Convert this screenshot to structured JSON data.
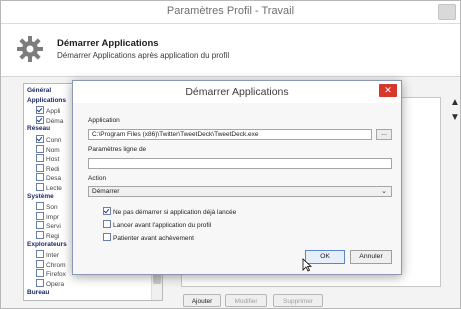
{
  "window": {
    "title": "Paramètres Profil - Travail"
  },
  "header": {
    "icon": "gear-icon",
    "title": "Démarrer Applications",
    "subtitle": "Démarrer Applications après application du profil"
  },
  "tree": {
    "items": [
      {
        "label": "Général",
        "level": "cat",
        "checked": null
      },
      {
        "label": "Applications",
        "level": "cat",
        "checked": null
      },
      {
        "label": "Appli",
        "level": "sub",
        "checked": true
      },
      {
        "label": "Déma",
        "level": "sub",
        "checked": true
      },
      {
        "label": "Réseau",
        "level": "cat",
        "checked": null
      },
      {
        "label": "Conn",
        "level": "sub",
        "checked": true
      },
      {
        "label": "Nom",
        "level": "sub",
        "checked": false
      },
      {
        "label": "Host",
        "level": "sub",
        "checked": false
      },
      {
        "label": "Redi",
        "level": "sub",
        "checked": false
      },
      {
        "label": "Desa",
        "level": "sub",
        "checked": false
      },
      {
        "label": "Lecte",
        "level": "sub",
        "checked": false
      },
      {
        "label": "Système",
        "level": "cat",
        "checked": null
      },
      {
        "label": "Son",
        "level": "sub",
        "checked": false
      },
      {
        "label": "Impr",
        "level": "sub",
        "checked": false
      },
      {
        "label": "Servi",
        "level": "sub",
        "checked": false
      },
      {
        "label": "Regi",
        "level": "sub",
        "checked": false
      },
      {
        "label": "Explorateurs",
        "level": "cat",
        "checked": null
      },
      {
        "label": "Inter",
        "level": "sub",
        "checked": false
      },
      {
        "label": "Chrom",
        "level": "sub",
        "checked": false
      },
      {
        "label": "Firefox",
        "level": "sub",
        "checked": false
      },
      {
        "label": "Opera",
        "level": "sub",
        "checked": false
      },
      {
        "label": "Bureau",
        "level": "cat",
        "checked": null
      }
    ]
  },
  "list_buttons": {
    "add": "Ajouter",
    "edit": "Modifier",
    "delete": "Supprimer"
  },
  "dialog": {
    "title": "Démarrer Applications",
    "close_glyph": "✕",
    "application_label": "Application",
    "application_value": "C:\\Program Files (x86)\\Twitter\\TweetDeck\\TweetDeck.exe",
    "browse_label": "...",
    "params_label": "Paramètres ligne de",
    "params_value": "",
    "action_label": "Action",
    "action_value": "Démarrer",
    "options": [
      {
        "label": "Ne pas démarrer si application déjà lancée",
        "checked": true
      },
      {
        "label": "Lancer avant l'application du profil",
        "checked": false
      },
      {
        "label": "Patienter avant achèvement",
        "checked": false
      }
    ],
    "ok_label": "OK",
    "cancel_label": "Annuler"
  }
}
